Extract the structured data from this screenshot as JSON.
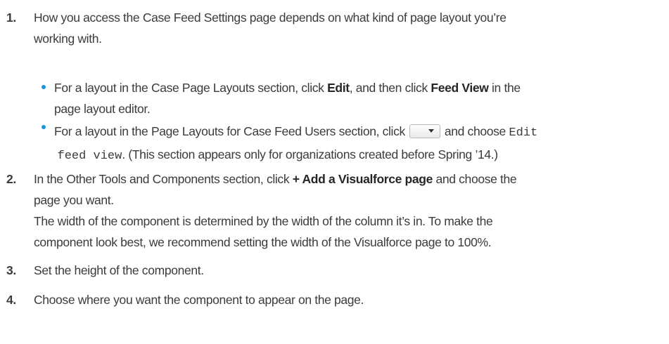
{
  "steps": [
    {
      "number": "1.",
      "line1": "How you access the Case Feed Settings page depends on what kind of page layout you’re",
      "line2": "working with.",
      "bullets": [
        {
          "pre": "For a layout in the Case Page Layouts section, click ",
          "bold1": "Edit",
          "mid": ", and then click ",
          "bold2": "Feed View",
          "post": " in the",
          "line2": "page layout editor."
        },
        {
          "pre": "For a layout in the Page Layouts for Case Feed Users section, click",
          "mid": "and choose ",
          "code1": "Edit",
          "code2": "feed view",
          "post": ". (This section appears only for organizations created before Spring ’14.)"
        }
      ]
    },
    {
      "number": "2.",
      "pre": "In the Other Tools and Components section, click ",
      "bold": "+ Add a Visualforce page",
      "post": " and choose the",
      "line2": "page you want.",
      "line3": "The width of the component is determined by the width of the column it’s in. To make the",
      "line4": "component look best, we recommend setting the width of the Visualforce page to 100%."
    },
    {
      "number": "3.",
      "text": "Set the height of the component."
    },
    {
      "number": "4.",
      "text": "Choose where you want the component to appear on the page."
    }
  ],
  "colors": {
    "bullet": "#1b96d8",
    "text": "#3b3b3b"
  },
  "icons": {
    "dropdown": "chevron-down-icon"
  }
}
